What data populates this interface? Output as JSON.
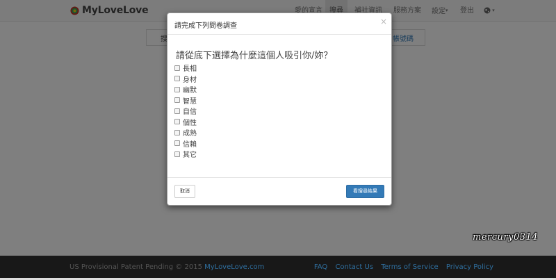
{
  "navbar": {
    "brand": "MyLoveLove",
    "items": [
      {
        "label": "愛的宣言",
        "active": false
      },
      {
        "label": "搜尋",
        "active": true
      },
      {
        "label": "補社資訊",
        "active": false
      },
      {
        "label": "服務方案",
        "active": false
      },
      {
        "label": "設定",
        "active": false,
        "caret": true
      },
      {
        "label": "登出",
        "active": false
      }
    ],
    "language_icon": "globe-icon"
  },
  "page": {
    "subbar_left": "搜",
    "subbar_link": "帳號碼"
  },
  "modal": {
    "title": "請完成下列問卷調查",
    "close": "×",
    "question": "請從底下選擇為什麼這個人吸引你/妳？",
    "options": [
      {
        "label": "長相",
        "checked": false
      },
      {
        "label": "身材",
        "checked": false
      },
      {
        "label": "幽默",
        "checked": false
      },
      {
        "label": "智慧",
        "checked": false
      },
      {
        "label": "自信",
        "checked": false
      },
      {
        "label": "個性",
        "checked": false
      },
      {
        "label": "成熟",
        "checked": false
      },
      {
        "label": "信賴",
        "checked": false
      },
      {
        "label": "其它",
        "checked": false
      }
    ],
    "cancel_label": "取消",
    "submit_label": "看搜尋結果"
  },
  "footer": {
    "copyright": "US Provisional Patent Pending © 2015",
    "site": "MyLoveLove.com",
    "links": [
      "FAQ",
      "Contact Us",
      "Terms of Service",
      "Privacy Policy"
    ]
  },
  "watermark": "mercury0314",
  "colors": {
    "primary": "#337ab7",
    "footer_bg": "#181818",
    "link": "#2f6f9f"
  }
}
